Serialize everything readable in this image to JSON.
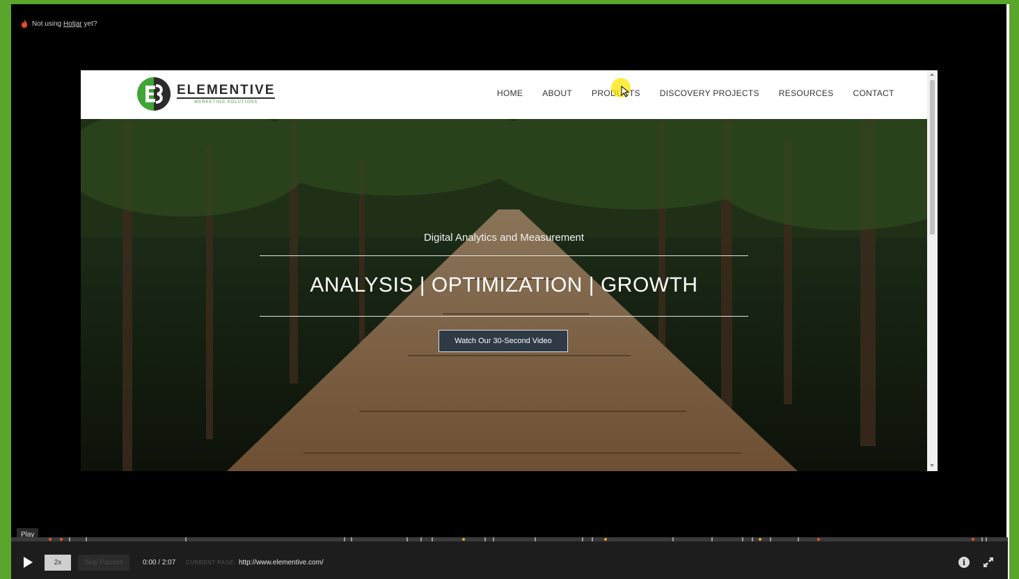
{
  "banner": {
    "prefix": "Not using ",
    "link": "Hotjar",
    "suffix": " yet?"
  },
  "site": {
    "logo_word": "ELEMENTIVE",
    "logo_sub": "MARKETING SOLUTIONS",
    "nav": [
      "HOME",
      "ABOUT",
      "PRODUCTS",
      "DISCOVERY PROJECTS",
      "RESOURCES",
      "CONTACT"
    ],
    "hero_sub": "Digital Analytics and Measurement",
    "hero_title": "ANALYSIS | OPTIMIZATION | GROWTH",
    "hero_button": "Watch Our 30-Second Video"
  },
  "player": {
    "tooltip": "Play",
    "speed": "2x",
    "skip": "Skip Pauses",
    "time": "0:00 / 2:07",
    "current_page_label": "CURRENT PAGE:",
    "current_page_url": "http://www.elementive.com/"
  },
  "colors": {
    "frame": "#5aa52c",
    "accent_dot": "#e8542a",
    "highlight": "#ffe600"
  }
}
